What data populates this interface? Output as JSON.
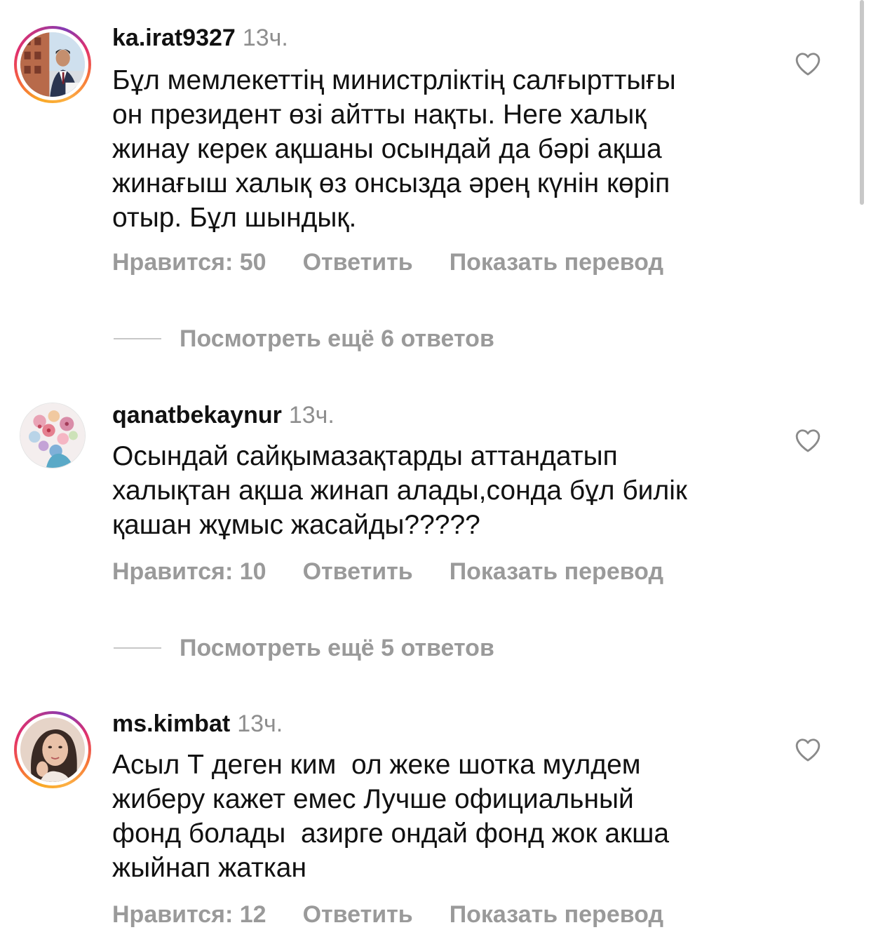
{
  "comments": [
    {
      "username": "ka.irat9327",
      "time": "13ч.",
      "text": "Бұл мемлекеттің министрліктің салғырттығы\nон президент өзі айтты нақты. Неге халық\nжинау керек ақшаны осындай да бәрі ақша\nжинағыш халық өз онсызда әрең күнін көріп\nотыр. Бұл шындық.",
      "likes": "Нравится: 50",
      "reply": "Ответить",
      "translate": "Показать перевод",
      "more_replies": "Посмотреть ещё 6 ответов",
      "avatar_ring": true
    },
    {
      "username": "qanatbekaynur",
      "time": "13ч.",
      "text": "Осындай сайқымазақтарды аттандатып\nхалықтан ақша жинап алады,сонда бұл билік\nқашан жұмыс жасайды?????",
      "likes": "Нравится: 10",
      "reply": "Ответить",
      "translate": "Показать перевод",
      "more_replies": "Посмотреть ещё 5 ответов",
      "avatar_ring": false
    },
    {
      "username": "ms.kimbat",
      "time": "13ч.",
      "text": "Асыл Т деген ким  ол жеке шотка мулдем\nжиберу кажет емес Лучше официальный\nфонд болады  азирге ондай фонд жок акша\nжыйнап жаткан",
      "likes": "Нравится: 12",
      "reply": "Ответить",
      "translate": "Показать перевод",
      "avatar_ring": true
    }
  ],
  "colors": {
    "text": "#111111",
    "muted": "#9a9a9a",
    "timestamp": "#8e8e8e",
    "ring_gradient": [
      "#f9a825",
      "#e1306c",
      "#833ab4"
    ]
  },
  "icons": {
    "like": "heart-outline-icon"
  }
}
